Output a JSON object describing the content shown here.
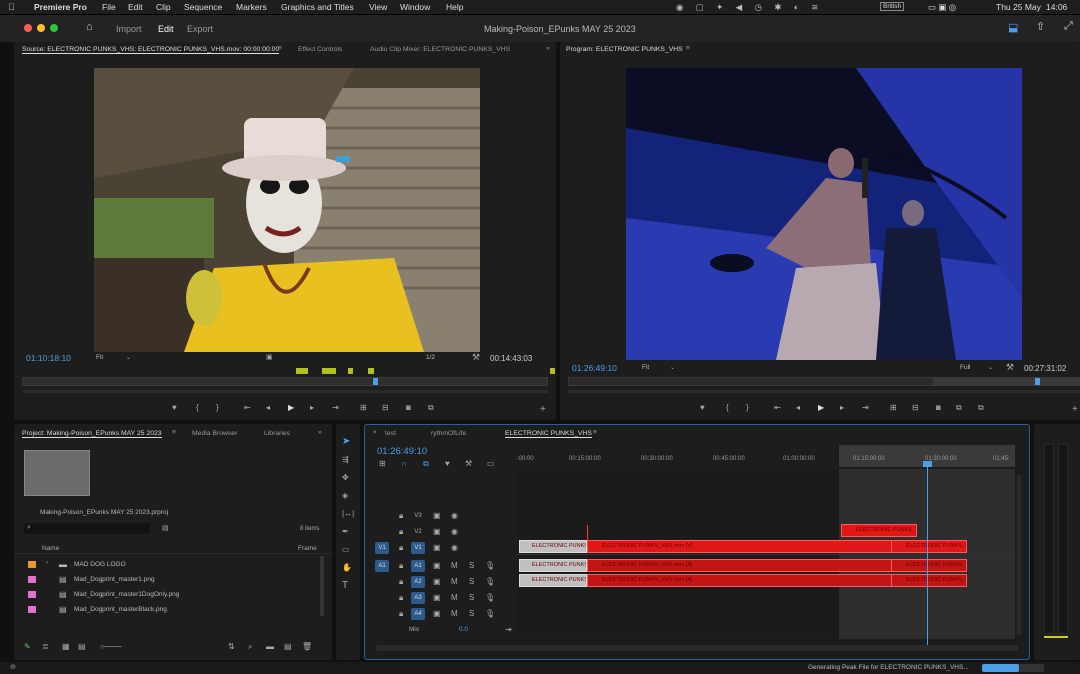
{
  "menubar": {
    "app": "Premiere Pro",
    "items": [
      "File",
      "Edit",
      "Clip",
      "Sequence",
      "Markers",
      "Graphics and Titles",
      "View",
      "Window",
      "Help"
    ],
    "keyboard": "British",
    "date": "Thu 25 May",
    "time": "14:06"
  },
  "appbar": {
    "workspaces": [
      "Import",
      "Edit",
      "Export"
    ],
    "active": "Edit",
    "title": "Making-Poison_EPunks MAY 25 2023"
  },
  "source": {
    "tabs": [
      "Source: ELECTRONIC PUNKS_VHS: ELECTRONIC PUNKS_VHS.mov: 00:00:00:00",
      "Effect Controls",
      "Audio Clip Mixer: ELECTRONIC PUNKS_VHS"
    ],
    "timecode": "01:10:18:10",
    "fit": "Fit",
    "resolution": "1/2",
    "duration": "00:14:43:03"
  },
  "program": {
    "tab": "Program: ELECTRONIC PUNKS_VHS",
    "timecode": "01:26:49:10",
    "fit": "Fit",
    "resolution": "Full",
    "duration": "00:27:31:02"
  },
  "project": {
    "tabs": [
      "Project: Making-Poison_EPunks MAY 25 2023",
      "Media Browser",
      "Libraries"
    ],
    "filename": "Making-Poison_EPunks MAY 25 2023.prproj",
    "count": "8 items",
    "col_name": "Name",
    "col_frame": "Frame",
    "items": [
      {
        "name": "MAD DOG LOGO",
        "color": "#e89a2a",
        "folder": true
      },
      {
        "name": "Mad_Dogprint_master1.png",
        "color": "#e070d0",
        "folder": false
      },
      {
        "name": "Mad_Dogprint_master1DogOnly.png",
        "color": "#e070d0",
        "folder": false
      },
      {
        "name": "Mad_Dogprint_masterBlack.png",
        "color": "#e070d0",
        "folder": false
      }
    ]
  },
  "timeline": {
    "tabs": [
      "test",
      "rythmOfLife",
      "ELECTRONIC PUNKS_VHS"
    ],
    "timecode": "01:26:49:10",
    "ruler": [
      ":00:00",
      "00:15:00:00",
      "00:30:00:00",
      "00:45:00:00",
      "01:00:00:00",
      "01:15:00:00",
      "01:30:00:00",
      "01:45:"
    ],
    "video_tracks": [
      "V3",
      "V2",
      "V1"
    ],
    "audio_tracks": [
      "A1",
      "A2",
      "A3",
      "A4"
    ],
    "source_v": "V1",
    "source_a": "A1",
    "mix": "Mix",
    "mix_value": "0.0",
    "clip_name": "ELECTRONIC PUNKS_VHS.mov [V]",
    "clip_name_a": "ELECTRONIC PUNKS_VHS.mov [A]"
  },
  "status": {
    "text": "Generating Peak File for ELECTRONIC PUNKS_VHS...",
    "progress": 0.6
  }
}
